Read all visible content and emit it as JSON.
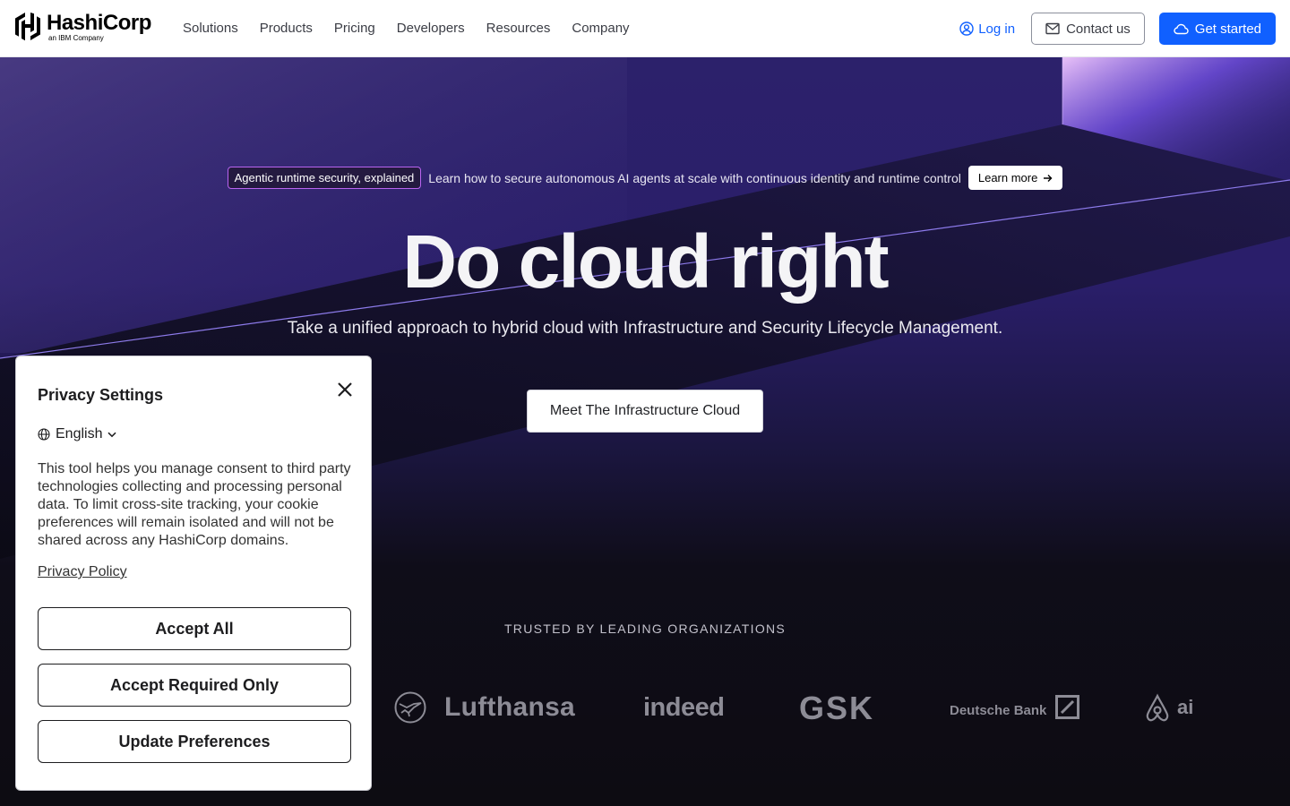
{
  "header": {
    "logo_name": "HashiCorp",
    "logo_sub": "an IBM Company",
    "nav": [
      "Solutions",
      "Products",
      "Pricing",
      "Developers",
      "Resources",
      "Company"
    ],
    "login_label": "Log in",
    "contact_label": "Contact us",
    "start_label": "Get started"
  },
  "hero": {
    "announce_tag": "Agentic runtime security, explained",
    "announce_text": "Learn how to secure autonomous AI agents at scale with continuous identity and runtime control",
    "announce_button": "Learn more",
    "title": "Do cloud right",
    "subtitle": "Take a unified approach to hybrid cloud with Infrastructure and Security Lifecycle Management.",
    "cta_label": "Meet The Infrastructure Cloud",
    "trusted_label": "TRUSTED BY LEADING ORGANIZATIONS",
    "logos": {
      "lufthansa": "Lufthansa",
      "indeed": "indeed",
      "gsk": "GSK",
      "deutsche_bank": "Deutsche Bank",
      "airbnb": "ai"
    }
  },
  "privacy": {
    "title": "Privacy Settings",
    "language": "English",
    "description": "This tool helps you manage consent to third party technologies collecting and processing personal data. To limit cross-site tracking, your cookie preferences will remain isolated and will not be shared across any HashiCorp domains.",
    "policy_link": "Privacy Policy",
    "accept_all": "Accept All",
    "accept_required": "Accept Required Only",
    "update_preferences": "Update Preferences"
  },
  "colors": {
    "accent": "#1060ff",
    "hero_purple": "#2c216b",
    "tag_border": "#b964f0"
  }
}
